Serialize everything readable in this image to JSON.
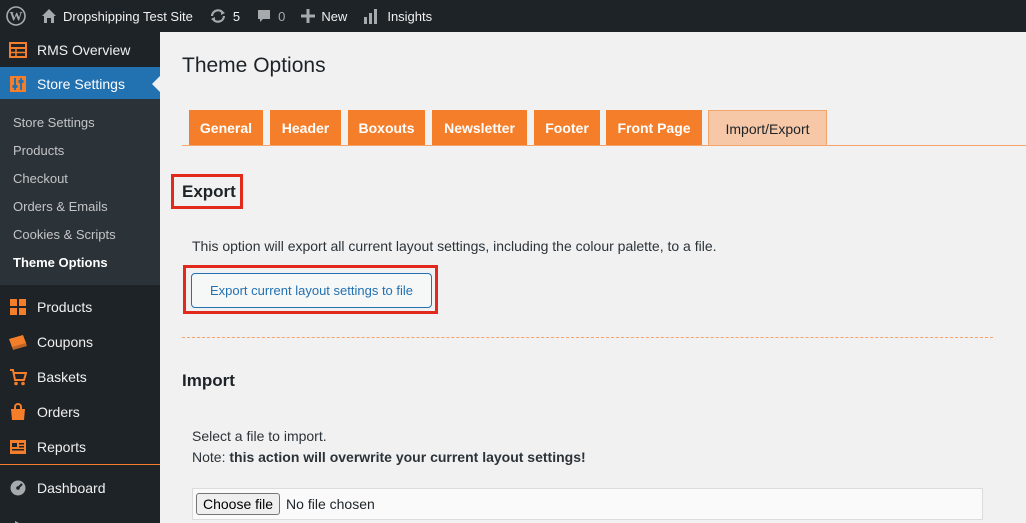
{
  "admin_bar": {
    "site_name": "Dropshipping Test Site",
    "updates_count": "5",
    "comments_count": "0",
    "new_label": "New",
    "insights_label": "Insights"
  },
  "sidebar": {
    "top_items": [
      {
        "label": "RMS Overview",
        "icon": "table-grid-icon"
      },
      {
        "label": "Store Settings",
        "icon": "sliders-icon",
        "current": true
      }
    ],
    "submenu": [
      {
        "label": "Store Settings"
      },
      {
        "label": "Products"
      },
      {
        "label": "Checkout"
      },
      {
        "label": "Orders & Emails"
      },
      {
        "label": "Cookies & Scripts"
      },
      {
        "label": "Theme Options",
        "active": true
      }
    ],
    "bottom_items": [
      {
        "label": "Products",
        "icon": "grid-icon"
      },
      {
        "label": "Coupons",
        "icon": "coupon-icon"
      },
      {
        "label": "Baskets",
        "icon": "cart-icon"
      },
      {
        "label": "Orders",
        "icon": "bag-icon"
      },
      {
        "label": "Reports",
        "icon": "report-icon"
      },
      {
        "label": "Dashboard",
        "icon": "dashboard-gauge-icon"
      }
    ],
    "accent_color": "#f47e2a",
    "current_color": "#2271b1"
  },
  "page": {
    "title": "Theme Options",
    "tabs": [
      {
        "label": "General"
      },
      {
        "label": "Header"
      },
      {
        "label": "Boxouts"
      },
      {
        "label": "Newsletter"
      },
      {
        "label": "Footer"
      },
      {
        "label": "Front Page"
      },
      {
        "label": "Import/Export",
        "active": true
      }
    ],
    "export": {
      "heading": "Export",
      "description": "This option will export all current layout settings, including the colour palette, to a file.",
      "button_label": "Export current layout settings to file"
    },
    "import": {
      "heading": "Import",
      "description": "Select a file to import.",
      "note_prefix": "Note: ",
      "note_bold": "this action will overwrite your current layout settings!",
      "choose_file_label": "Choose file",
      "file_status": "No file chosen"
    },
    "tab_color": "#f47e2a",
    "highlight_color": "#e3291b"
  }
}
